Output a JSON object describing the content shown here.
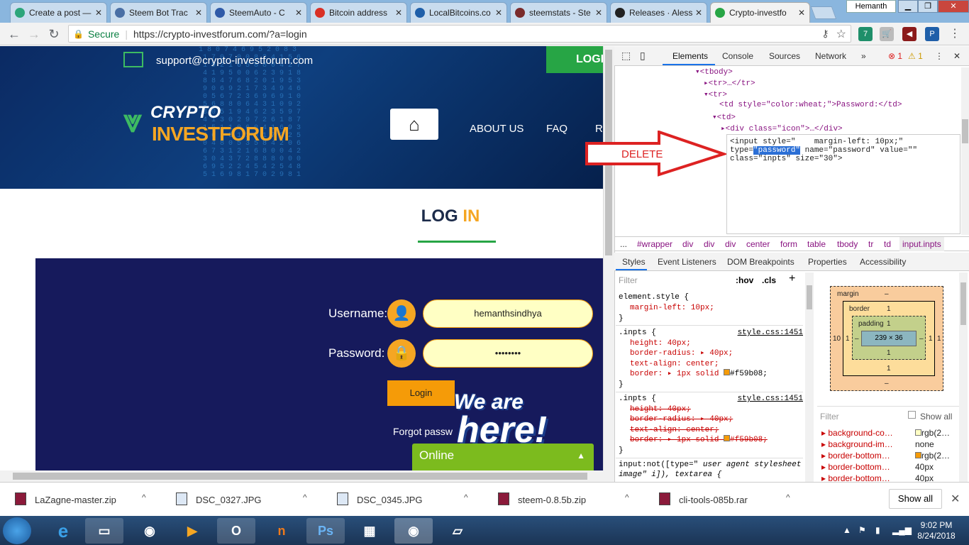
{
  "browser": {
    "tabs": [
      {
        "title": "Create a post —",
        "icon_color": "#2ca57a"
      },
      {
        "title": "Steem Bot Trac",
        "icon_color": "#4a6fa5"
      },
      {
        "title": "SteemAuto - C",
        "icon_color": "#2f5aa8"
      },
      {
        "title": "Bitcoin address",
        "icon_color": "#d93025"
      },
      {
        "title": "LocalBitcoins.co",
        "icon_color": "#1f5fa9"
      },
      {
        "title": "steemstats - Ste",
        "icon_color": "#7a2b2b"
      },
      {
        "title": "Releases · Aless",
        "icon_color": "#222222"
      },
      {
        "title": "Crypto-investfo",
        "icon_color": "#27a545"
      }
    ],
    "user": "Hemanth",
    "secure_label": "Secure",
    "url": "https://crypto-investforum.com/?a=login",
    "extension_badge": "7"
  },
  "site": {
    "support_email": "support@crypto-investforum.com",
    "login_top": "LOGI",
    "logo_line1": "CRYPTO",
    "logo_line2": "INVESTFORUM",
    "nav": [
      "ABOUT US",
      "FAQ",
      "R"
    ],
    "title_main": "LOG",
    "title_accent": "IN",
    "username_label": "Username:",
    "password_label": "Password:",
    "username_value": "hemanthsindhya",
    "password_value": "••••••••",
    "login_button": "Login",
    "forgot": "Forgot passw",
    "promo_line1": "We are",
    "promo_line2": "here!",
    "online": "Online"
  },
  "devtools": {
    "tabs": [
      "Elements",
      "Console",
      "Sources",
      "Network"
    ],
    "error_count": "1",
    "warning_count": "1",
    "dom": {
      "tbody": "▾<tbody>",
      "tr1": "▸<tr>…</tr>",
      "tr2": "▾<tr>",
      "td_open": "<td style=\"color:wheat;\">Password:</td>",
      "td2": "▾<td>",
      "div_icon": "▸<div class=\"icon\">…</div>",
      "edit_line1": "<input style=\"    margin-left: 10px;\"",
      "edit_type_prefix": "type=",
      "edit_type_value": "\"password\"",
      "edit_line2_rest": " name=\"password\" value=\"\"",
      "edit_line3": "class=\"inpts\" size=\"30\">"
    },
    "annotation": "DELETE",
    "breadcrumbs": [
      "...",
      "#wrapper",
      "div",
      "div",
      "div",
      "center",
      "form",
      "table",
      "tbody",
      "tr",
      "td",
      "input.inpts"
    ],
    "styles_tabs": [
      "Styles",
      "Event Listeners",
      "DOM Breakpoints",
      "Properties",
      "Accessibility"
    ],
    "filter_placeholder": "Filter",
    "hov": ":hov",
    "cls": ".cls",
    "rules": {
      "r1_sel": "element.style {",
      "r1_p1": "margin-left: 10px;",
      "r2_sel": ".inpts {",
      "r2_link": "style.css:1451",
      "r2_p1": "height: 40px;",
      "r2_p2": "border-radius: ▸ 40px;",
      "r2_p3": "text-align: center;",
      "r2_p4": "border: ▸ 1px solid ",
      "r2_p4_color": "#f59b08;",
      "r3_sel": ".inpts {",
      "r3_link": "style.css:1451",
      "r3_p1": "height: 40px;",
      "r3_p2": "border-radius: ▸ 40px;",
      "r3_p3": "text-align: center;",
      "r3_p4": "border: ▸ 1px solid ",
      "r3_p4_color": "#f59b08;",
      "r4_sel": "input:not([type=\"",
      "r4_ua": "user agent stylesheet",
      "r4_sel2": "image\" i]), textarea {"
    },
    "box_model": {
      "margin": "margin",
      "margin_dash": "–",
      "border": "border",
      "border_val": "1",
      "padding": "padding",
      "padding_val": "1",
      "content": "239 × 36",
      "left_margin": "10",
      "side": "1",
      "bottom_padding": "1",
      "bottom_border": "1",
      "bottom_margin": "–",
      "right_margin": "–",
      "right_border": "1"
    },
    "computed_filter": "Filter",
    "show_all": "Show all",
    "computed": [
      {
        "prop": "background-co…",
        "val": "rgb(2…"
      },
      {
        "prop": "background-im…",
        "val": "none"
      },
      {
        "prop": "border-bottom…",
        "val": "rgb(2…"
      },
      {
        "prop": "border-bottom…",
        "val": "40px"
      },
      {
        "prop": "border-bottom…",
        "val": "40px"
      }
    ]
  },
  "downloads": {
    "items": [
      "LaZagne-master.zip",
      "DSC_0327.JPG",
      "DSC_0345.JPG",
      "steem-0.8.5b.zip",
      "cli-tools-085b.rar"
    ],
    "show_all": "Show all"
  },
  "taskbar": {
    "time": "9:02 PM",
    "date": "8/24/2018",
    "apps": [
      "ie",
      "explorer",
      "chrome",
      "media",
      "outlook",
      "app-n",
      "photoshop",
      "calculator",
      "chrome-active",
      "notes"
    ]
  }
}
